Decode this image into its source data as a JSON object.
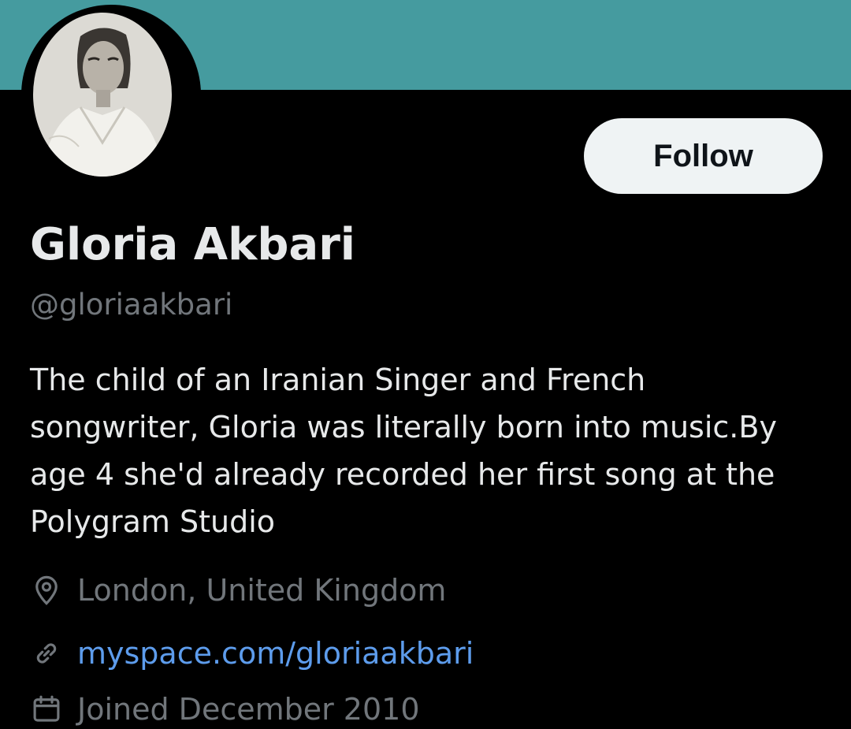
{
  "profile": {
    "display_name": "Gloria Akbari",
    "handle": "@gloriaakbari",
    "bio_lines": [
      "The child of an Iranian Singer and French",
      "songwriter, Gloria was literally born into music.By",
      "age 4 she'd already recorded her first song at the",
      "Polygram Studio"
    ],
    "location": "London, United Kingdom",
    "website": "myspace.com/gloriaakbari",
    "joined": "Joined December 2010"
  },
  "actions": {
    "follow_label": "Follow"
  },
  "icons": {
    "location": "location-pin-icon",
    "website": "link-icon",
    "joined": "calendar-icon"
  },
  "colors": {
    "banner": "#459b9f",
    "background": "#000000",
    "primary_text": "#e7e9ea",
    "secondary_text": "#71767b",
    "link": "#5d9cec",
    "follow_button_bg": "#eff3f4",
    "follow_button_text": "#0f1419"
  }
}
